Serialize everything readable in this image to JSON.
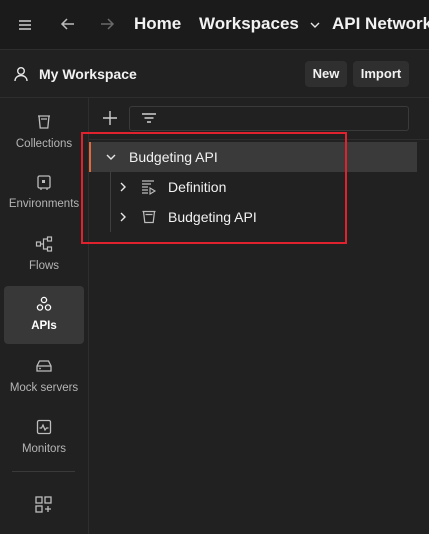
{
  "topbar": {
    "home": "Home",
    "workspaces": "Workspaces",
    "api_network": "API Network"
  },
  "workspace": {
    "title": "My Workspace",
    "new_label": "New",
    "import_label": "Import"
  },
  "rail": {
    "items": [
      {
        "label": "Collections",
        "icon": "collections-icon"
      },
      {
        "label": "Environments",
        "icon": "environments-icon"
      },
      {
        "label": "Flows",
        "icon": "flows-icon"
      },
      {
        "label": "APIs",
        "icon": "apis-icon",
        "active": true
      },
      {
        "label": "Mock servers",
        "icon": "mock-servers-icon"
      },
      {
        "label": "Monitors",
        "icon": "monitors-icon"
      }
    ]
  },
  "tree": {
    "root": {
      "label": "Budgeting API",
      "expanded": true,
      "selected": true
    },
    "children": [
      {
        "label": "Definition",
        "icon": "definition-icon",
        "expanded": false
      },
      {
        "label": "Budgeting API",
        "icon": "collection-icon",
        "expanded": false
      }
    ]
  },
  "colors": {
    "accent": "#e0683c",
    "highlight": "#e0222e",
    "background": "#212121",
    "selected_row": "#3a3a3a"
  }
}
